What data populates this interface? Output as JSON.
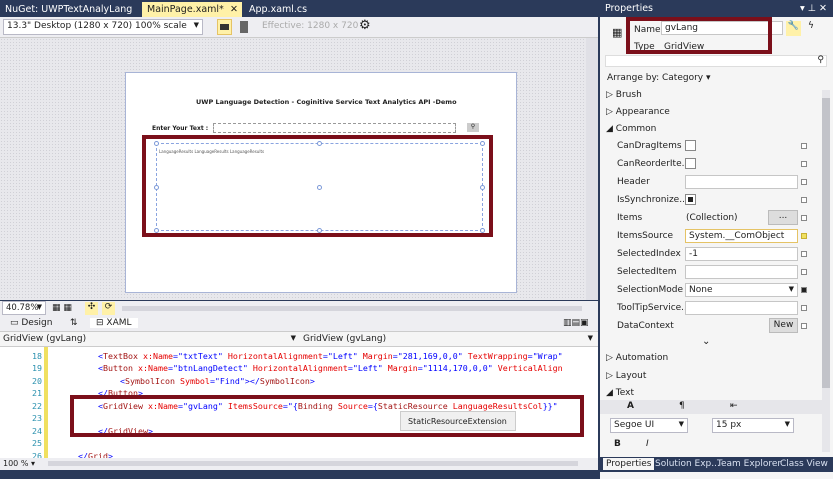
{
  "tabs": [
    {
      "label": "NuGet: UWPTextAnalyLang"
    },
    {
      "label": "MainPage.xaml*",
      "active": true
    },
    {
      "label": "App.xaml.cs"
    }
  ],
  "toolbar": {
    "device": "13.3\" Desktop (1280 x 720) 100% scale",
    "effective": "Effective: 1280 x 720"
  },
  "artboard": {
    "title": "UWP Language Detection - Coginitive Service Text Analytics API -Demo",
    "enter_label": "Enter Your Text :",
    "grid_text": "LanguageResults LanguageResults LanguageResults"
  },
  "zoom": {
    "value": "40.78%"
  },
  "view_tabs": {
    "design": "Design",
    "swap": "⇅",
    "xaml": "XAML"
  },
  "scope": {
    "left": "GridView (gvLang)",
    "right": "GridView (gvLang)"
  },
  "code": {
    "lines": [
      "18",
      "19",
      "20",
      "21",
      "22",
      "23",
      "24",
      "25",
      "26"
    ],
    "tooltip": "StaticResourceExtension",
    "zoom": "100 %"
  },
  "properties": {
    "title": "Properties",
    "name_label": "Name",
    "name_value": "gvLang",
    "type_label": "Type",
    "type_value": "GridView",
    "arrange": "Arrange by: Category ▾",
    "cats": {
      "brush": "Brush",
      "appearance": "Appearance",
      "common": "Common",
      "automation": "Automation",
      "layout": "Layout",
      "text": "Text"
    },
    "rows": [
      {
        "label": "CanDragItems"
      },
      {
        "label": "CanReorderIte..."
      },
      {
        "label": "Header",
        "value": ""
      },
      {
        "label": "IsSynchronize..."
      },
      {
        "label": "Items",
        "value": "(Collection)",
        "button": "..."
      },
      {
        "label": "ItemsSource",
        "value": "System.__ComObject"
      },
      {
        "label": "SelectedIndex",
        "value": "-1"
      },
      {
        "label": "SelectedItem",
        "value": ""
      },
      {
        "label": "SelectionMode",
        "value": "None"
      },
      {
        "label": "ToolTipService...",
        "value": ""
      },
      {
        "label": "DataContext",
        "button": "New"
      }
    ],
    "font": "Segoe UI",
    "font_size": "15 px",
    "bold": "B",
    "italic": "I",
    "text_icons": {
      "font": "A",
      "para": "¶"
    },
    "tabs": [
      "Properties",
      "Solution Exp...",
      "Team Explorer",
      "Class View"
    ]
  },
  "colors": {
    "highlight": "#7b0f1a",
    "chrome": "#2b3a5a",
    "active_tab": "#fff1a8"
  }
}
